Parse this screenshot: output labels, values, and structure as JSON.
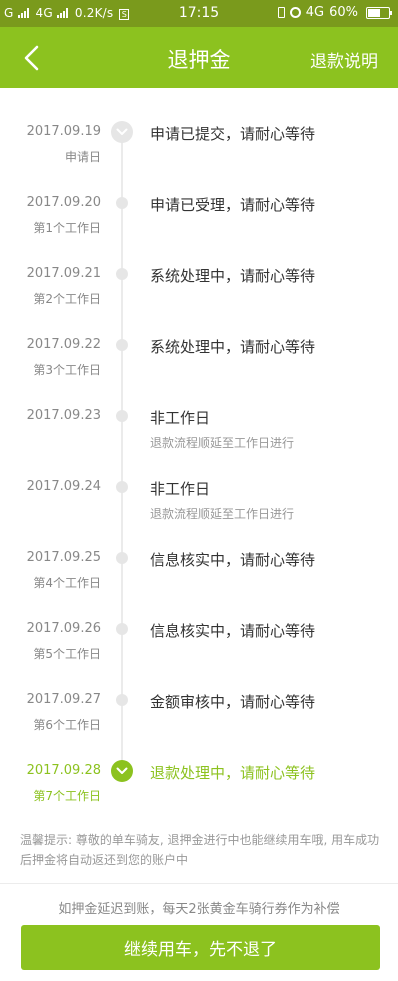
{
  "status_bar": {
    "carrier1": "G",
    "network2": "4G",
    "speed": "0.2K/s",
    "time": "17:15",
    "network_right": "4G",
    "battery_percent": "60%",
    "battery_level": 0.6
  },
  "nav": {
    "title": "退押金",
    "right_link": "退款说明",
    "back_icon": "chevron-left-icon"
  },
  "timeline": {
    "steps": [
      {
        "date": "2017.09.19",
        "sub": "申请日",
        "title": "申请已提交，请耐心等待",
        "desc": "",
        "marker": "done"
      },
      {
        "date": "2017.09.20",
        "sub": "第1个工作日",
        "title": "申请已受理，请耐心等待",
        "desc": "",
        "marker": "dot"
      },
      {
        "date": "2017.09.21",
        "sub": "第2个工作日",
        "title": "系统处理中，请耐心等待",
        "desc": "",
        "marker": "dot"
      },
      {
        "date": "2017.09.22",
        "sub": "第3个工作日",
        "title": "系统处理中，请耐心等待",
        "desc": "",
        "marker": "dot"
      },
      {
        "date": "2017.09.23",
        "sub": "",
        "title": "非工作日",
        "desc": "退款流程顺延至工作日进行",
        "marker": "dot"
      },
      {
        "date": "2017.09.24",
        "sub": "",
        "title": "非工作日",
        "desc": "退款流程顺延至工作日进行",
        "marker": "dot"
      },
      {
        "date": "2017.09.25",
        "sub": "第4个工作日",
        "title": "信息核实中，请耐心等待",
        "desc": "",
        "marker": "dot"
      },
      {
        "date": "2017.09.26",
        "sub": "第5个工作日",
        "title": "信息核实中，请耐心等待",
        "desc": "",
        "marker": "dot"
      },
      {
        "date": "2017.09.27",
        "sub": "第6个工作日",
        "title": "金额审核中，请耐心等待",
        "desc": "",
        "marker": "dot"
      },
      {
        "date": "2017.09.28",
        "sub": "第7个工作日",
        "title": "退款处理中，请耐心等待",
        "desc": "",
        "marker": "current"
      }
    ]
  },
  "tip": "温馨提示: 尊敬的单车骑友, 退押金进行中也能继续用车哦, 用车成功后押金将自动返还到您的账户中",
  "footer": {
    "compensation": "如押金延迟到账，每天2张黄金车骑行券作为补偿",
    "button": "继续用车，先不退了"
  },
  "colors": {
    "accent": "#8cc21f",
    "status_bar": "#7a9a1c",
    "text": "#333333",
    "muted": "#888888"
  }
}
